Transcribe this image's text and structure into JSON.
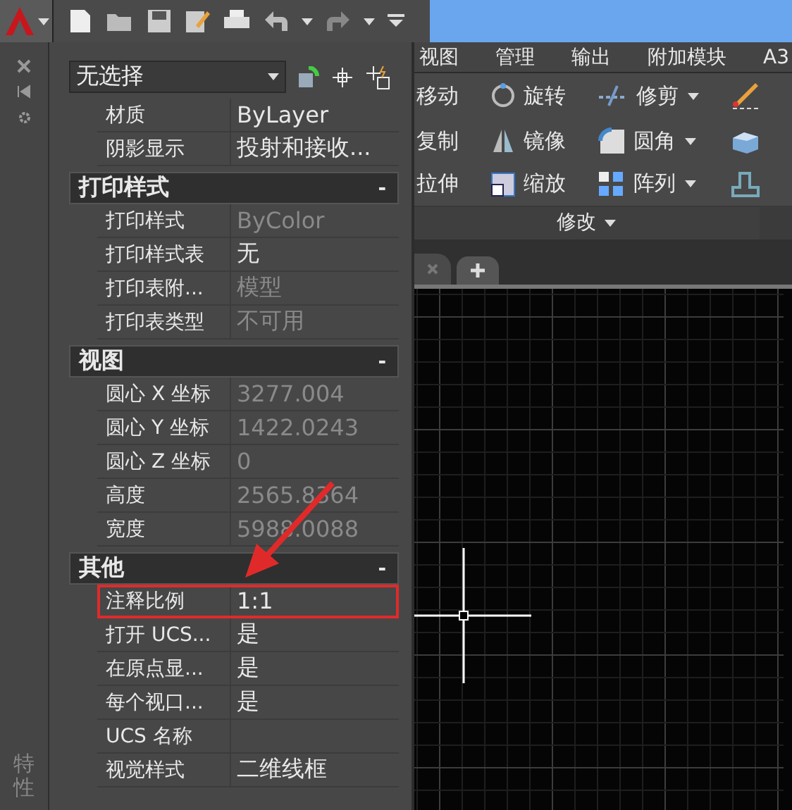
{
  "ribbon_tabs": [
    {
      "label": "视图",
      "selected": false
    },
    {
      "label": "管理",
      "selected": false
    },
    {
      "label": "输出",
      "selected": false
    },
    {
      "label": "附加模块",
      "selected": false
    },
    {
      "label": "A3",
      "selected": false
    }
  ],
  "ribbon_tools": [
    [
      {
        "label": "移动",
        "kind": "plain"
      },
      {
        "label": "旋转",
        "kind": "rotate"
      },
      {
        "label": "修剪",
        "kind": "trim",
        "dropdown": true
      },
      {
        "kind": "brush"
      }
    ],
    [
      {
        "label": "复制",
        "kind": "plain"
      },
      {
        "label": "镜像",
        "kind": "mirror"
      },
      {
        "label": "圆角",
        "kind": "fillet",
        "dropdown": true
      },
      {
        "kind": "blocks"
      }
    ],
    [
      {
        "label": "拉伸",
        "kind": "plain"
      },
      {
        "label": "缩放",
        "kind": "scale"
      },
      {
        "label": "阵列",
        "kind": "array",
        "dropdown": true
      },
      {
        "kind": "outline"
      }
    ]
  ],
  "panel_title": "修改",
  "palette": {
    "side_title": "特性",
    "selector": "无选择",
    "top_rows": [
      {
        "label": "材质",
        "value": "ByLayer",
        "disabled": false,
        "highlighted": false
      },
      {
        "label": "阴影显示",
        "value": "投射和接收...",
        "disabled": false,
        "highlighted": false
      }
    ],
    "sections": [
      {
        "title": "打印样式",
        "toggle": "-",
        "rows": [
          {
            "label": "打印样式",
            "value": "ByColor",
            "disabled": true,
            "highlighted": false
          },
          {
            "label": "打印样式表",
            "value": "无",
            "disabled": false,
            "highlighted": false
          },
          {
            "label": "打印表附...",
            "value": "模型",
            "disabled": true,
            "highlighted": false
          },
          {
            "label": "打印表类型",
            "value": "不可用",
            "disabled": true,
            "highlighted": false
          }
        ]
      },
      {
        "title": "视图",
        "toggle": "-",
        "rows": [
          {
            "label": "圆心 X 坐标",
            "value": "3277.004",
            "disabled": true,
            "highlighted": false
          },
          {
            "label": "圆心 Y 坐标",
            "value": "1422.0243",
            "disabled": true,
            "highlighted": false
          },
          {
            "label": "圆心 Z 坐标",
            "value": "0",
            "disabled": true,
            "highlighted": false
          },
          {
            "label": "高度",
            "value": "2565.8364",
            "disabled": true,
            "highlighted": false
          },
          {
            "label": "宽度",
            "value": "5988.0088",
            "disabled": true,
            "highlighted": false
          }
        ]
      },
      {
        "title": "其他",
        "toggle": "-",
        "rows": [
          {
            "label": "注释比例",
            "value": "1:1",
            "disabled": false,
            "highlighted": true
          },
          {
            "label": "打开 UCS...",
            "value": "是",
            "disabled": false,
            "highlighted": false
          },
          {
            "label": "在原点显...",
            "value": "是",
            "disabled": false,
            "highlighted": false
          },
          {
            "label": "每个视口...",
            "value": "是",
            "disabled": false,
            "highlighted": false
          },
          {
            "label": "UCS 名称",
            "highlighted": false
          },
          {
            "label": "视觉样式",
            "value": "二维线框",
            "disabled": false,
            "highlighted": false
          }
        ]
      }
    ]
  }
}
